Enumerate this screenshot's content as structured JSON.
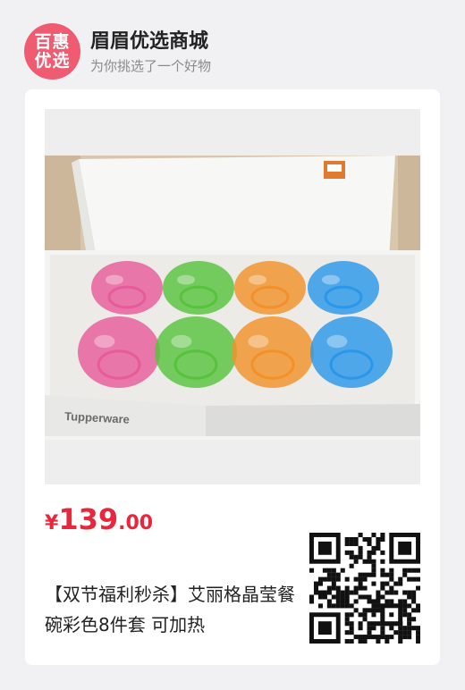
{
  "header": {
    "logo_line1": "百惠",
    "logo_line2": "优选",
    "shop_name": "眉眉优选商城",
    "subtitle": "为你挑选了一个好物"
  },
  "product": {
    "price_symbol": "¥",
    "price_int": "139",
    "price_decimal": ".00",
    "title": "【双节福利秒杀】艾丽格晶莹餐碗彩色8件套 可加热",
    "brand_text": "Tupperware",
    "bowl_colors": [
      "#e85b9a",
      "#58c23e",
      "#f2912a",
      "#2b97e8"
    ]
  },
  "qr": {
    "icon": "qr-code-icon"
  }
}
